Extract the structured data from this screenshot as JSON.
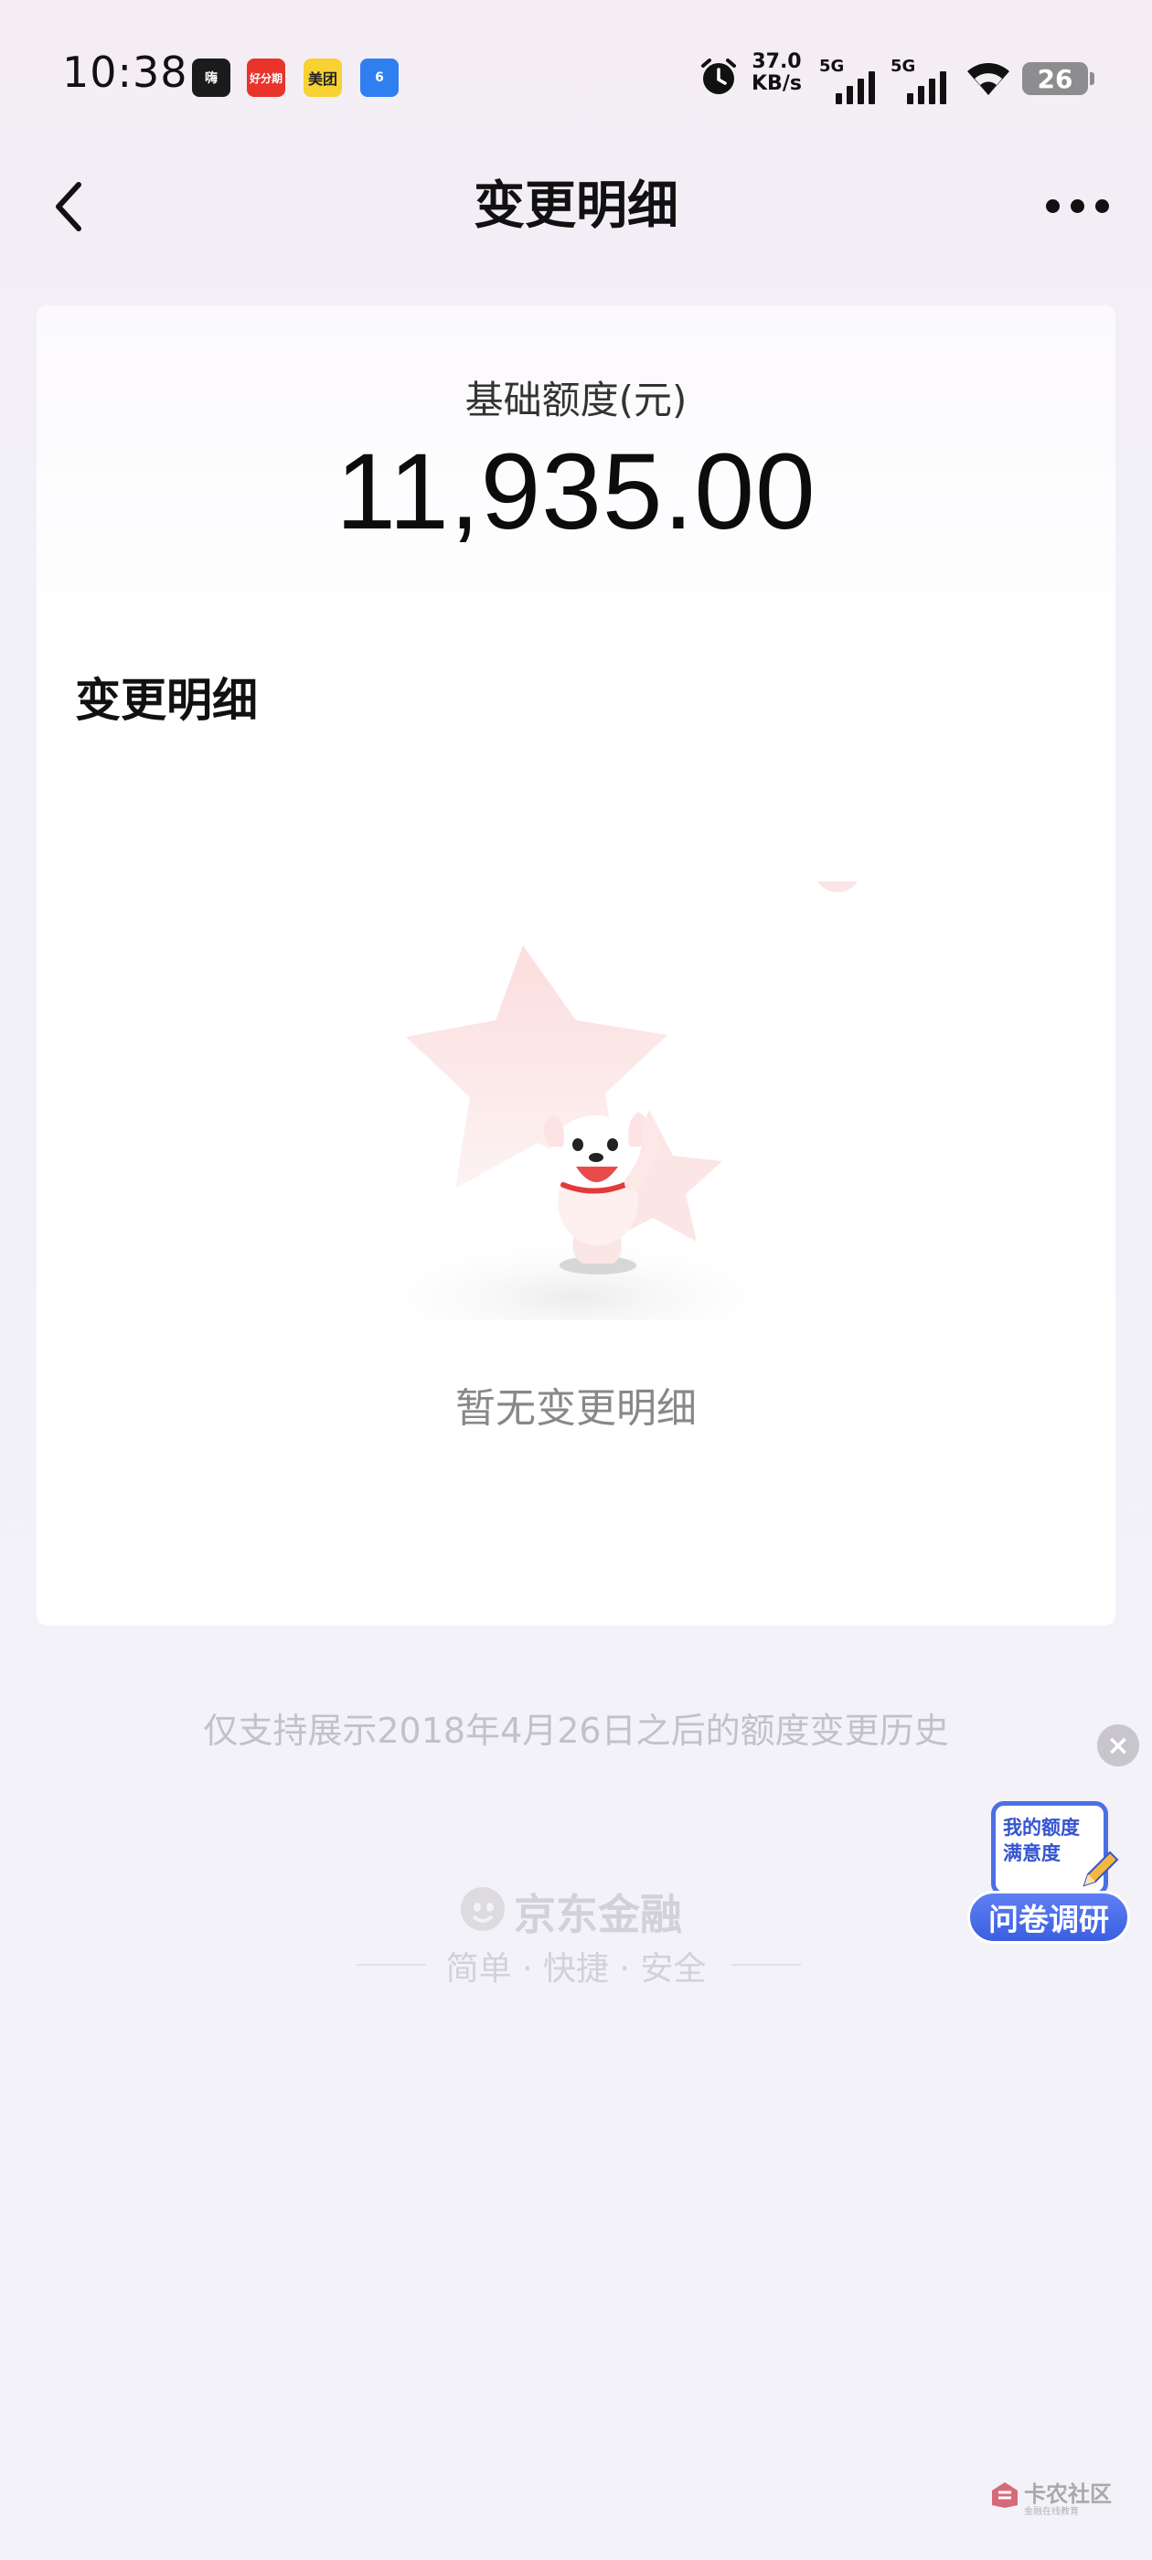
{
  "status_bar": {
    "time": "10:38",
    "apps": [
      {
        "name": "app-icon-1",
        "label": "嗨"
      },
      {
        "name": "app-icon-2",
        "label": "好分期"
      },
      {
        "name": "app-icon-3",
        "label": "美团"
      },
      {
        "name": "app-icon-4",
        "label": "6"
      }
    ],
    "net_speed_value": "37.0",
    "net_speed_unit": "KB/s",
    "sim1_label": "5G",
    "sim2_label": "5G",
    "battery": "26"
  },
  "nav": {
    "title": "变更明细"
  },
  "card": {
    "limit_label": "基础额度(元)",
    "limit_value": "11,935.00",
    "section_title": "变更明细",
    "empty_text": "暂无变更明细"
  },
  "footer": {
    "history_note": "仅支持展示2018年4月26日之后的额度变更历史",
    "brand_name": "京东金融",
    "slogan": "简单 · 快捷 · 安全"
  },
  "survey": {
    "card_line1": "我的额度",
    "card_line2": "满意度",
    "button_label": "问卷调研",
    "close_label": "×"
  },
  "watermark": {
    "title": "卡农社区",
    "subtitle": "金融在线教育"
  },
  "colors": {
    "accent_blue": "#4c6fe4",
    "brand_red": "#e8342b",
    "muted_text": "#888888"
  }
}
